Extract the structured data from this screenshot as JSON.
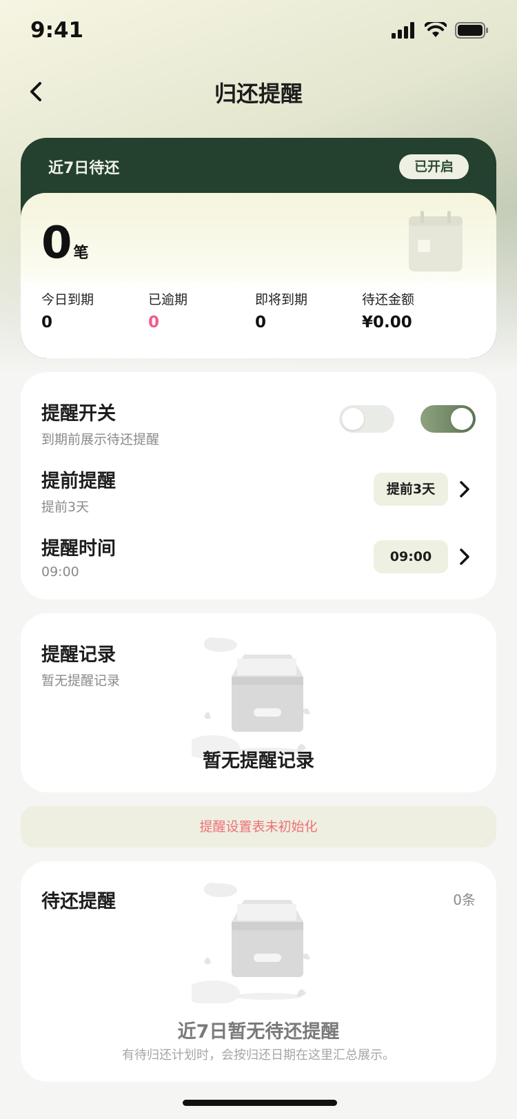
{
  "status": {
    "time": "9:41"
  },
  "nav": {
    "title": "归还提醒",
    "back_icon": "chevron-left-icon"
  },
  "summary": {
    "header": "近7日待还",
    "status_pill": "已开启",
    "count": "0",
    "count_unit": "笔",
    "stats": [
      {
        "label": "今日到期",
        "value": "0"
      },
      {
        "label": "已逾期",
        "value": "0"
      },
      {
        "label": "即将到期",
        "value": "0"
      },
      {
        "label": "待还金额",
        "value": "¥0.00"
      }
    ]
  },
  "settings": {
    "reminder_switch": {
      "title": "提醒开关",
      "subtitle": "到期前展示待还提醒"
    },
    "advance": {
      "title": "提前提醒",
      "subtitle": "提前3天",
      "chip": "提前3天"
    },
    "time": {
      "title": "提醒时间",
      "subtitle": "09:00",
      "chip": "09:00"
    }
  },
  "records": {
    "title": "提醒记录",
    "subtitle": "暂无提醒记录",
    "empty_text": "暂无提醒记录"
  },
  "notice": {
    "text": "提醒设置表未初始化"
  },
  "pending": {
    "title": "待还提醒",
    "count": "0条",
    "empty_title": "近7日暂无待还提醒",
    "empty_desc": "有待归还计划时，会按归还日期在这里汇总展示。"
  },
  "colors": {
    "accent": "#24402f",
    "overdue": "#f25b8a",
    "notice_text": "#f06f78"
  }
}
